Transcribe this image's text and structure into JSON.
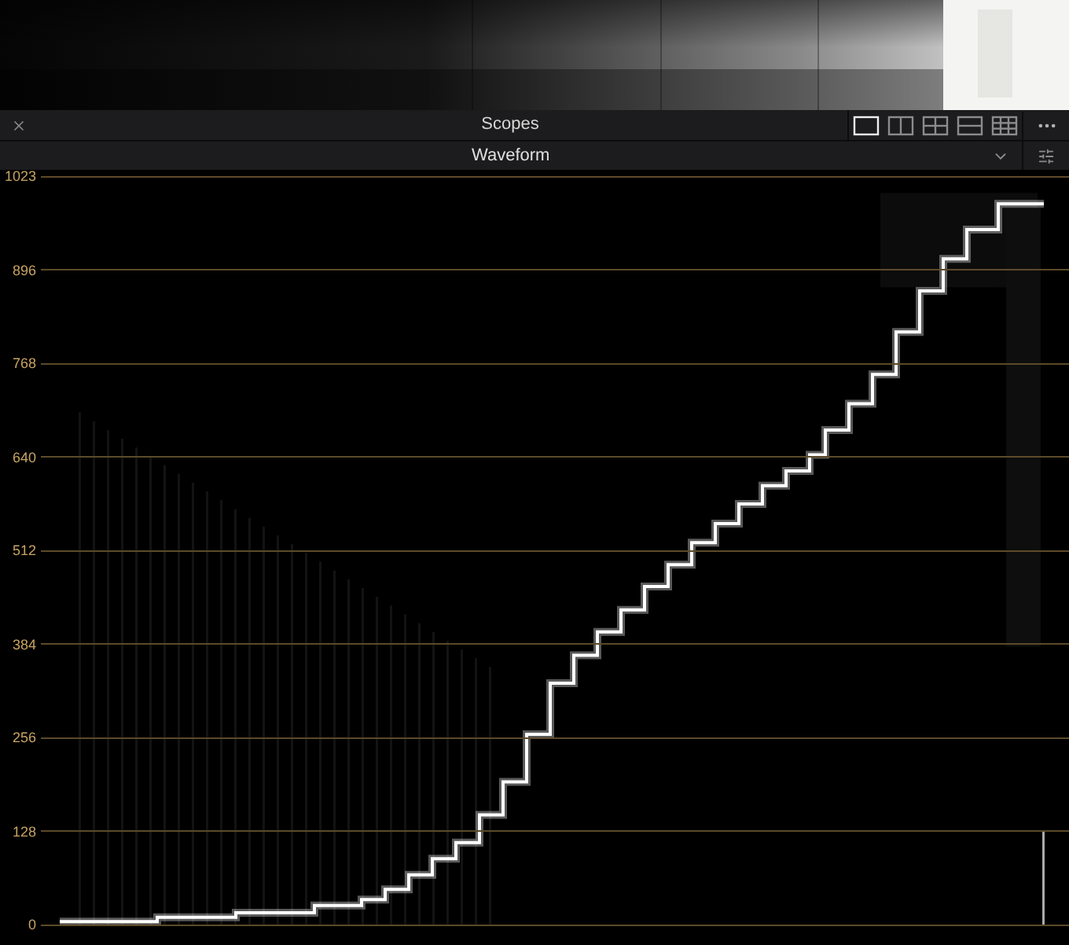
{
  "panel": {
    "title": "Scopes"
  },
  "layouts": [
    {
      "kind": "single",
      "selected": true
    },
    {
      "kind": "two",
      "selected": false
    },
    {
      "kind": "four",
      "selected": false
    },
    {
      "kind": "stack",
      "selected": false
    },
    {
      "kind": "grid",
      "selected": false
    }
  ],
  "scope_select": {
    "value": "Waveform"
  },
  "y_ticks": [
    "1023",
    "896",
    "768",
    "640",
    "512",
    "384",
    "256",
    "128",
    "0"
  ]
}
